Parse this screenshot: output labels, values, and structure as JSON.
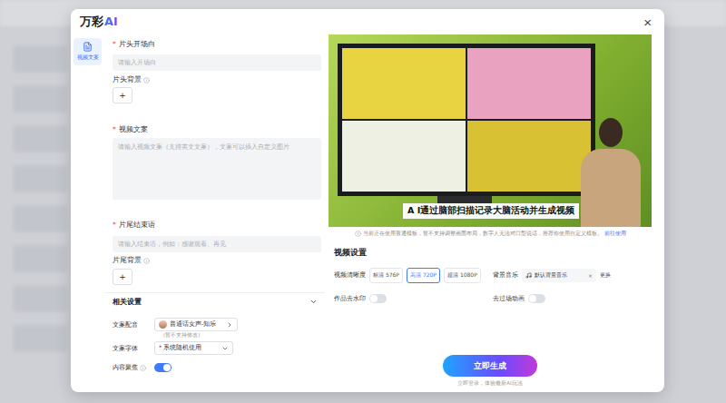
{
  "header": {
    "logo": "万彩",
    "logo_mark": "AI",
    "close": "×"
  },
  "nav": [
    {
      "label": "视频文案",
      "selected": true
    }
  ],
  "form": {
    "required_mark": "*",
    "fields": [
      {
        "kind": "input",
        "label": "片头开场白",
        "required": true,
        "info": false,
        "placeholder": "请输入开场白"
      },
      {
        "kind": "upload",
        "label": "片头背景",
        "required": false,
        "info": true,
        "button": "+"
      },
      {
        "kind": "textarea",
        "label": "视频文案",
        "required": true,
        "info": false,
        "placeholder": "请输入视频文案（支持英文文案），文案可以插入自定义图片"
      },
      {
        "kind": "input",
        "label": "片尾结束语",
        "required": true,
        "info": false,
        "placeholder": "请输入结束语，例如：感谢观看、再见"
      },
      {
        "kind": "upload",
        "label": "片尾背景",
        "required": false,
        "info": true,
        "button": "+"
      }
    ]
  },
  "settings": {
    "title": "相关设置",
    "expanded": true,
    "voice": {
      "label": "文案配音",
      "value": "普通话女声-知乐",
      "hint": "(暂不支持修改)"
    },
    "font": {
      "label": "文案字体",
      "value": "* 系统随机使用"
    },
    "focus": {
      "label": "内容聚焦",
      "info": true,
      "on": true
    }
  },
  "preview": {
    "caption": "A I通过脑部扫描记录大脑活动并生成视频"
  },
  "notice": {
    "text": "当前正在使用普通模板，暂不支持调整画面布局，数字人无法对口型说话，推荐你使用自定义模板。",
    "link": "前往使用"
  },
  "video_settings": {
    "title": "视频设置",
    "quality": {
      "label": "视频清晰度",
      "options": [
        {
          "label": "标清 576P",
          "selected": false
        },
        {
          "label": "高清 720P",
          "selected": true
        },
        {
          "label": "超清 1080P",
          "selected": false
        }
      ]
    },
    "music": {
      "label": "背景音乐",
      "value": "默认背景音乐",
      "clear": "×",
      "change": "更换"
    },
    "toggles": [
      {
        "label": "作品去水印",
        "on": false
      },
      {
        "label": "去过场动画",
        "on": false
      }
    ]
  },
  "generate": {
    "label": "立即生成",
    "hint": "立即登录，体验最新AI玩法"
  }
}
